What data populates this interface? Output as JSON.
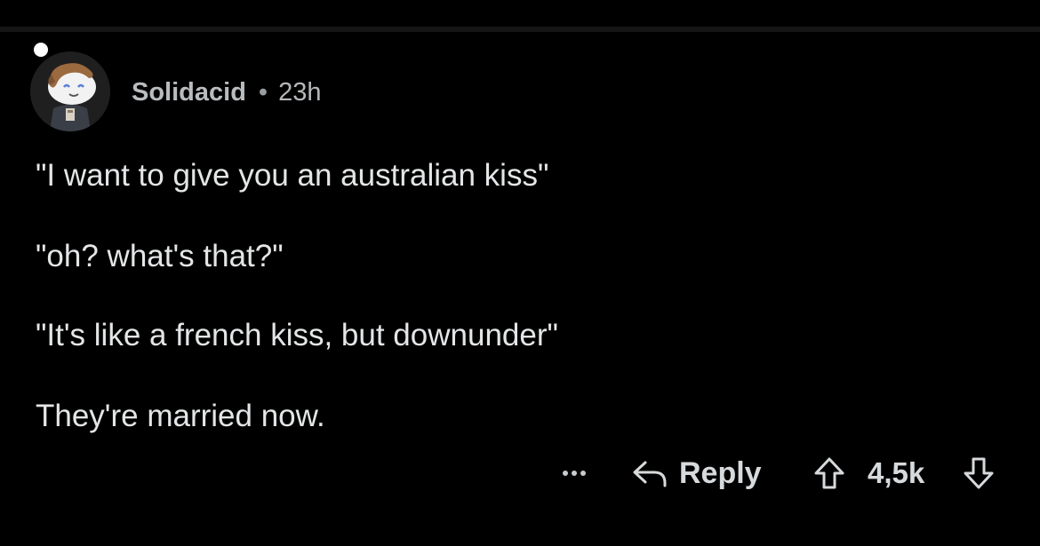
{
  "comment": {
    "author": "Solidacid",
    "separator": "•",
    "age": "23h",
    "body": [
      "\"I want to give you an australian kiss\"",
      "\"oh? what's that?\"",
      "\"It's like a french kiss, but downunder\"",
      "They're married now."
    ],
    "avatar_icon": "reddit-snoo-avatar",
    "online_indicator": true
  },
  "actions": {
    "more_icon": "more-dots-icon",
    "reply_icon": "reply-arrow-icon",
    "reply_label": "Reply",
    "upvote_icon": "upvote-arrow-icon",
    "score": "4,5k",
    "downvote_icon": "downvote-arrow-icon"
  },
  "colors": {
    "background": "#000000",
    "text": "#e3e5e6",
    "meta_text": "#b5b8ba"
  }
}
